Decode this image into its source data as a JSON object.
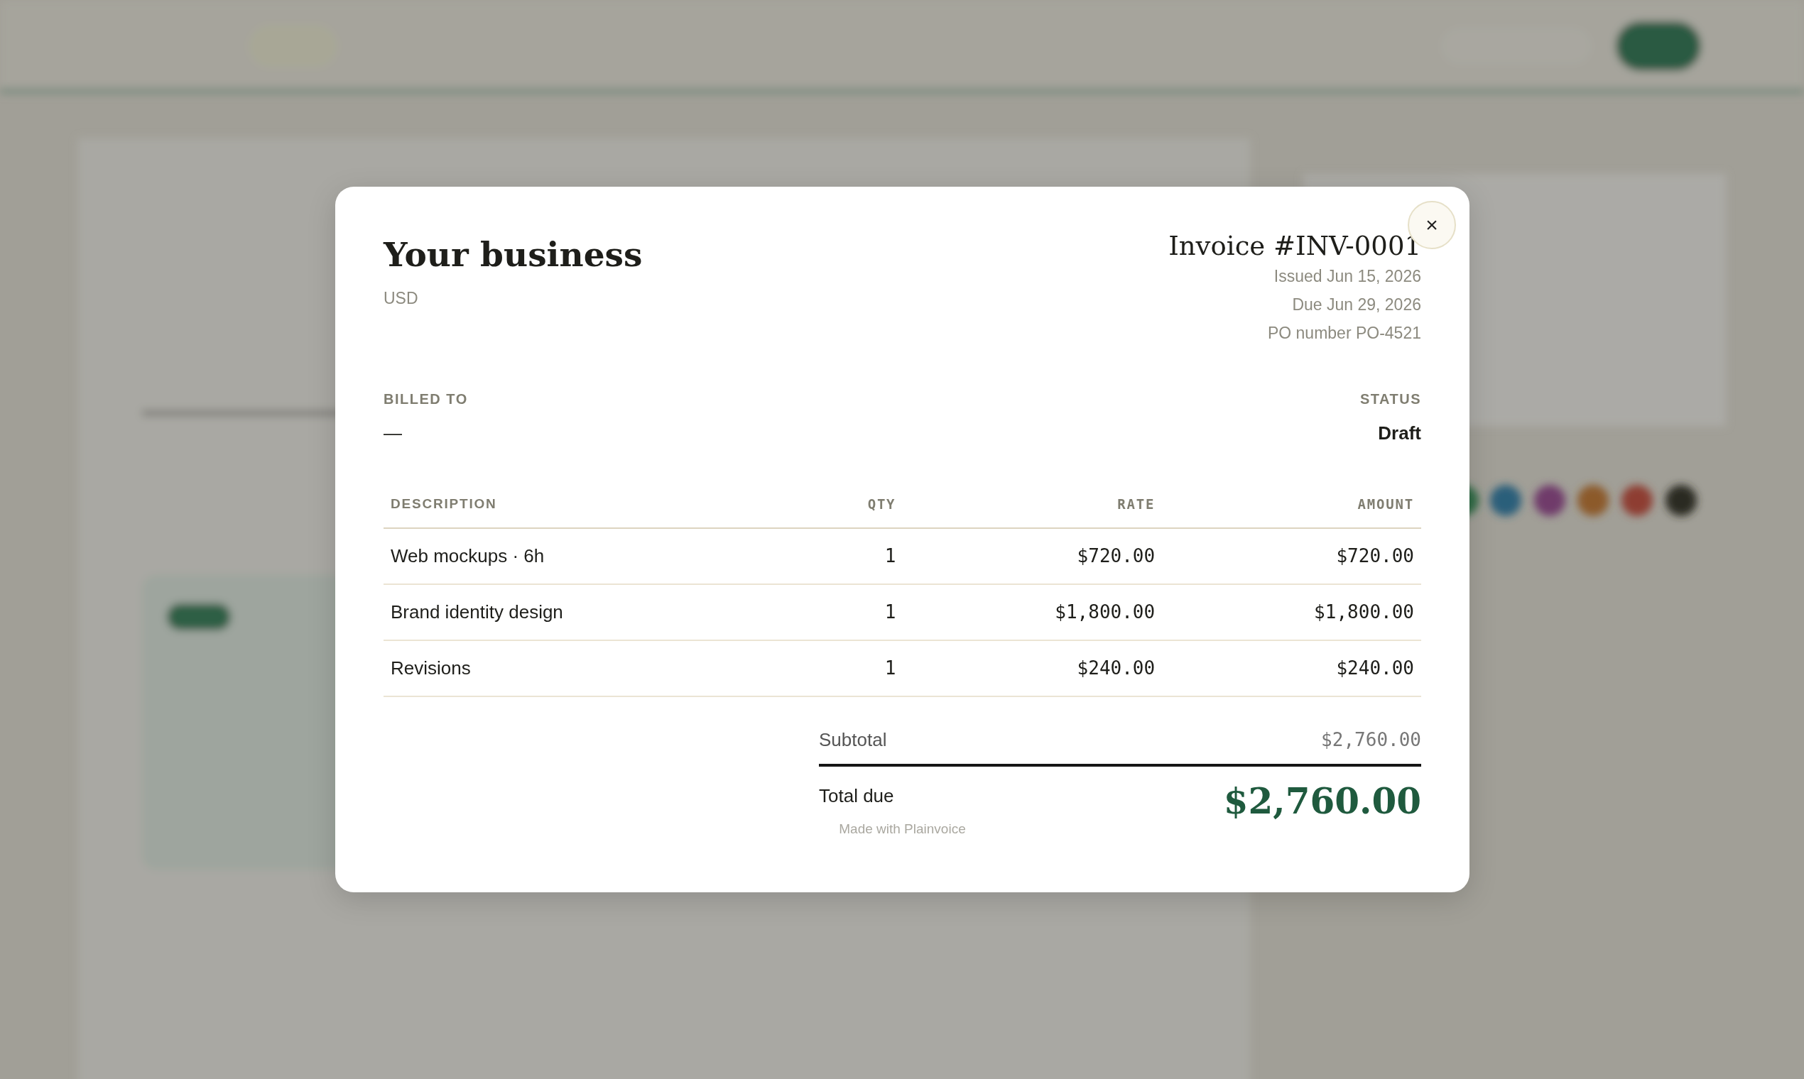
{
  "close_button": {
    "label": "×"
  },
  "business": {
    "name": "Your business",
    "currency": "USD"
  },
  "invoice": {
    "title": "Invoice #INV-0001",
    "lines": [
      "Issued Jun 15, 2026",
      "Due Jun 29, 2026",
      "PO number PO-4521"
    ]
  },
  "billed_to": {
    "label": "BILLED TO",
    "value": "—"
  },
  "status": {
    "label": "STATUS",
    "value": "Draft"
  },
  "table": {
    "columns": [
      "DESCRIPTION",
      "QTY",
      "RATE",
      "AMOUNT"
    ],
    "rows": [
      {
        "description": "Web mockups · 6h",
        "qty": "1",
        "rate": "$720.00",
        "amount": "$720.00"
      },
      {
        "description": "Brand identity design",
        "qty": "1",
        "rate": "$1,800.00",
        "amount": "$1,800.00"
      },
      {
        "description": "Revisions",
        "qty": "1",
        "rate": "$240.00",
        "amount": "$240.00"
      }
    ]
  },
  "totals": {
    "subtotal_label": "Subtotal",
    "subtotal": "$2,760.00",
    "total_label": "Total due",
    "total": "$2,760.00"
  },
  "footer": "Made with Plainvoice"
}
